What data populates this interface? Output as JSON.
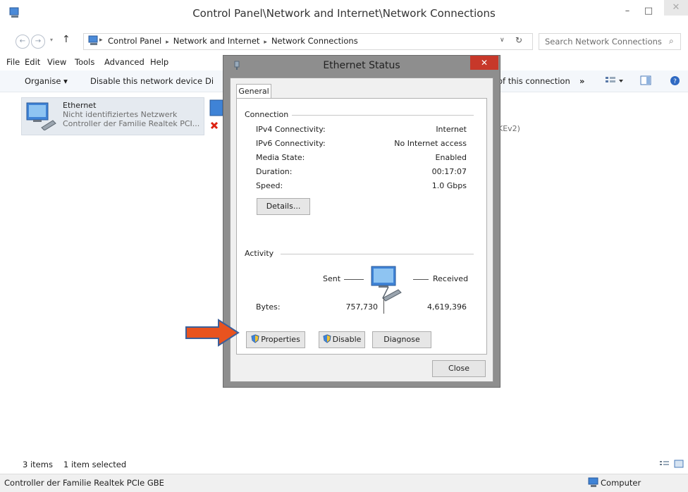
{
  "window": {
    "title": "Control Panel\\Network and Internet\\Network Connections",
    "minimize": "–",
    "maximize": "□",
    "close": "✕"
  },
  "address": {
    "crumbs": [
      "Control Panel",
      "Network and Internet",
      "Network Connections"
    ],
    "search_placeholder": "Search Network Connections"
  },
  "menu": [
    "File",
    "Edit",
    "View",
    "Tools",
    "Advanced",
    "Help"
  ],
  "toolbar": {
    "organise": "Organise ▾",
    "disable_device": "Disable this network device",
    "diagnose_partial": "Di",
    "view_status_partial": "of this connection",
    "more": "»"
  },
  "items": [
    {
      "name": "Ethernet",
      "status": "Nicht identifiziertes Netzwerk",
      "device": "Controller der Familie Realtek PCI..."
    }
  ],
  "partial_item_text": "KEv2)",
  "status": {
    "count": "3 items",
    "selected": "1 item selected"
  },
  "footer": {
    "description": "Controller der Familie Realtek PCIe GBE",
    "location": "Computer"
  },
  "dialog": {
    "title": "Ethernet Status",
    "close": "✕",
    "tab": "General",
    "connection_group": "Connection",
    "rows": [
      {
        "label": "IPv4 Connectivity:",
        "value": "Internet"
      },
      {
        "label": "IPv6 Connectivity:",
        "value": "No Internet access"
      },
      {
        "label": "Media State:",
        "value": "Enabled"
      },
      {
        "label": "Duration:",
        "value": "00:17:07"
      },
      {
        "label": "Speed:",
        "value": "1.0 Gbps"
      }
    ],
    "details_button": "Details...",
    "activity_group": "Activity",
    "sent_label": "Sent",
    "received_label": "Received",
    "bytes_label": "Bytes:",
    "bytes_sent": "757,730",
    "bytes_received": "4,619,396",
    "properties_button": "Properties",
    "disable_button": "Disable",
    "diagnose_button": "Diagnose",
    "close_button": "Close"
  },
  "colors": {
    "arrow": "#e8531f",
    "dialog_close": "#c7382a"
  }
}
